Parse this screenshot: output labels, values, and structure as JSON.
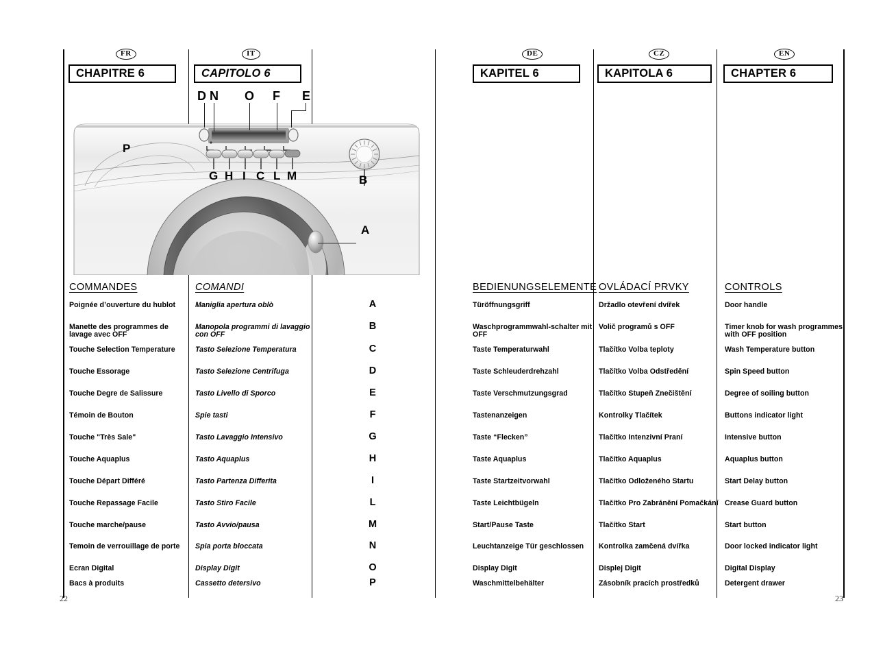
{
  "document": {
    "left_page_number": "22",
    "right_page_number": "23"
  },
  "languages": [
    {
      "code": "FR",
      "chapter": "CHAPITRE 6",
      "heading": "COMMANDES",
      "italic": false
    },
    {
      "code": "IT",
      "chapter": "CAPITOLO 6",
      "heading": "COMANDI",
      "italic": true
    },
    {
      "code": "DE",
      "chapter": "KAPITEL 6",
      "heading": "BEDIENUNGSELEMENTE",
      "italic": false
    },
    {
      "code": "CZ",
      "chapter": "KAPITOLA 6",
      "heading": "OVLÁDACÍ PRVKY",
      "italic": false
    },
    {
      "code": "EN",
      "chapter": "CHAPTER 6",
      "heading": "CONTROLS",
      "italic": false
    }
  ],
  "letters": [
    "A",
    "B",
    "C",
    "D",
    "E",
    "F",
    "G",
    "H",
    "I",
    "L",
    "M",
    "N",
    "O",
    "P"
  ],
  "controls": {
    "fr": [
      "Poignée d’ouverture du hublot",
      "Manette des programmes de lavage avec OFF",
      "Touche Selection Temperature",
      "Touche Essorage",
      "Touche Degre de Salissure",
      "Témoin de Bouton",
      "Touche \"Très Sale\"",
      "Touche Aquaplus",
      "Touche Départ Différé",
      "Touche Repassage Facile",
      "Touche marche/pause",
      "Temoin de verrouillage de porte",
      "Ecran Digital",
      "Bacs à produits"
    ],
    "it": [
      "Maniglia apertura oblò",
      "Manopola programmi di lavaggio con OFF",
      "Tasto Selezione Temperatura",
      "Tasto Selezione Centrifuga",
      "Tasto Livello di Sporco",
      "Spie tasti",
      "Tasto Lavaggio Intensivo",
      "Tasto Aquaplus",
      "Tasto Partenza Differita",
      "Tasto Stiro Facile",
      "Tasto Avvio/pausa",
      "Spia porta bloccata",
      "Display Digit",
      "Cassetto detersivo"
    ],
    "de": [
      "Türöffnungsgriff",
      "Waschprogrammwahl-schalter mit OFF",
      "Taste Temperaturwahl",
      "Taste Schleuderdrehzahl",
      "Taste Verschmutzungsgrad",
      "Tastenanzeigen",
      "Taste “Flecken”",
      "Taste Aquaplus",
      "Taste Startzeitvorwahl",
      "Taste Leichtbügeln",
      "Start/Pause Taste",
      "Leuchtanzeige Tür geschlossen",
      "Display Digit",
      "Waschmittelbehälter"
    ],
    "cz": [
      "Držadlo otevření dvířek",
      "Volič programů s OFF",
      "Tlačítko Volba teploty",
      "Tlačítko Volba Odstředění",
      "Tlačítko Stupeň Znečištění",
      "Kontrolky Tlačítek",
      "Tlačítko Intenzivní Praní",
      "Tlačítko Aquaplus",
      "Tlačítko Odloženého Startu",
      "Tlačítko Pro Zabránění Pomačkání",
      "Tlačítko Start",
      "Kontrolka zamčená dvířka",
      "Displej Digit",
      "Zásobník pracích prostředků"
    ],
    "en": [
      "Door handle",
      "Timer knob for wash programmes with OFF position",
      "Wash Temperature button",
      "Spin Speed button",
      "Degree of soiling button",
      "Buttons indicator light",
      "Intensive button",
      "Aquaplus button",
      "Start Delay button",
      "Crease Guard button",
      "Start button",
      "Door locked indicator light",
      "Digital Display",
      "Detergent drawer"
    ]
  },
  "diagram": {
    "caption": "washing-machine-control-panel",
    "top_callouts": [
      "D",
      "N",
      "O",
      "F",
      "E"
    ],
    "button_callouts": [
      "G",
      "H",
      "I",
      "C",
      "L",
      "M"
    ],
    "side_callouts": [
      "P",
      "B",
      "A"
    ]
  }
}
